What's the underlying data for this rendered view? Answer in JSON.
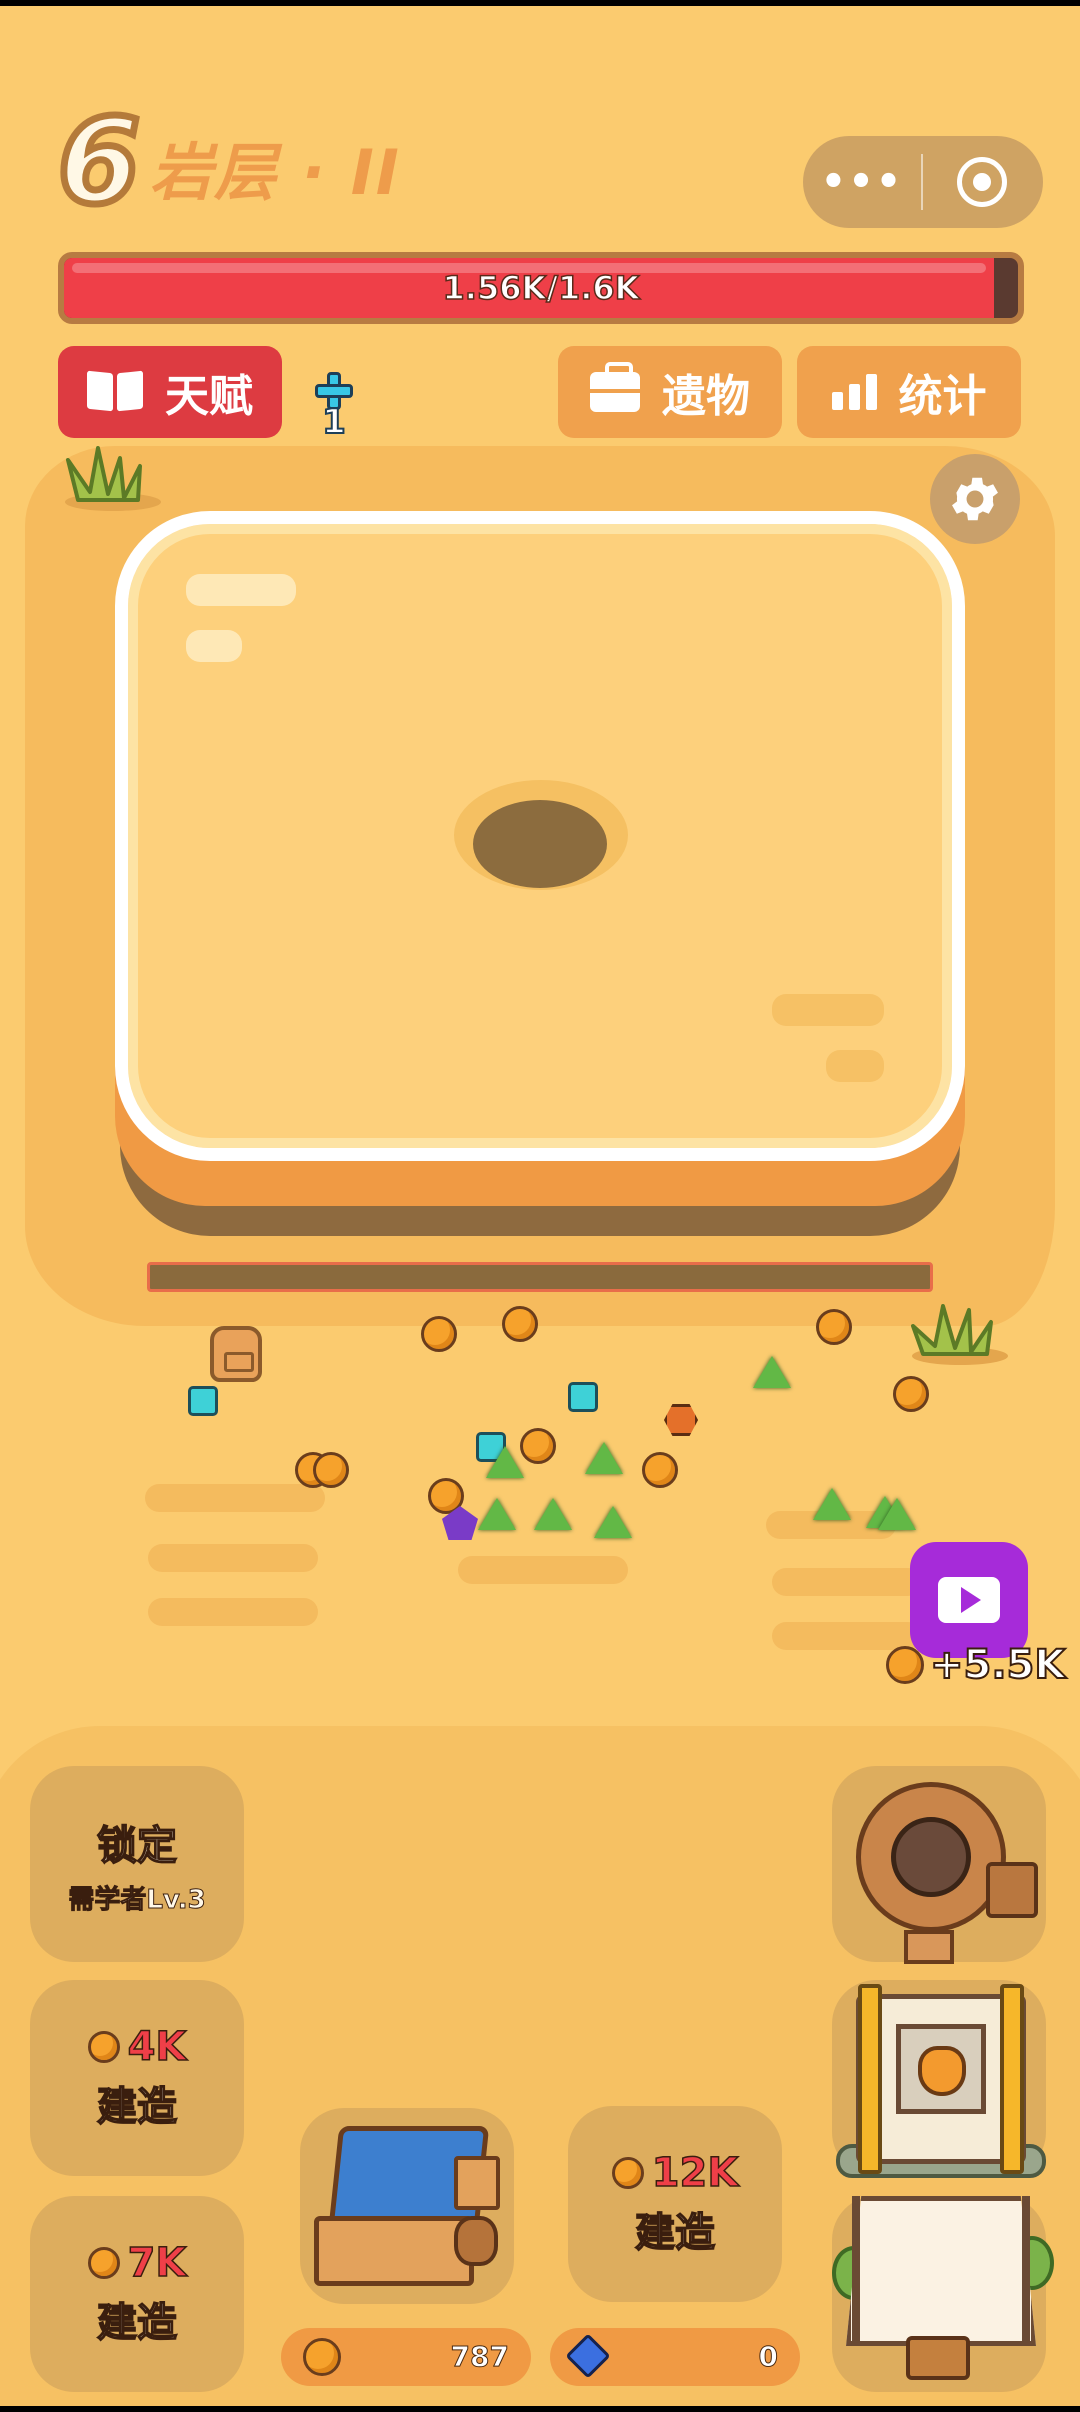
{
  "header": {
    "level_number": "6",
    "level_name": "岩层 · II"
  },
  "capsule": {
    "more_icon": "more-dots-icon",
    "close_icon": "target-circle-icon"
  },
  "boss_hp": {
    "text": "1.56K/1.6K",
    "current": 1560,
    "max": 1600
  },
  "buttons": {
    "talent": "天赋",
    "talent_points": "1",
    "relics": "遗物",
    "stats": "统计",
    "settings_icon": "gear-icon"
  },
  "dig_progress": 0,
  "ad_reward": {
    "amount": "+5.5K",
    "icon": "tv-play-icon"
  },
  "build_slots": {
    "locked": {
      "title": "锁定",
      "requirement": "需学者Lv.3"
    },
    "slot_4k": {
      "cost": "4K",
      "label": "建造"
    },
    "slot_7k": {
      "cost": "7K",
      "label": "建造"
    },
    "slot_12k": {
      "cost": "12K",
      "label": "建造"
    }
  },
  "currency": {
    "coins": "787",
    "gems": "0"
  },
  "colors": {
    "background": "#fbcb6f",
    "hp_red": "#ef3f48",
    "talent_red": "#dd3b41",
    "button_orange": "#f0a14d",
    "ad_purple": "#a62bd9"
  }
}
